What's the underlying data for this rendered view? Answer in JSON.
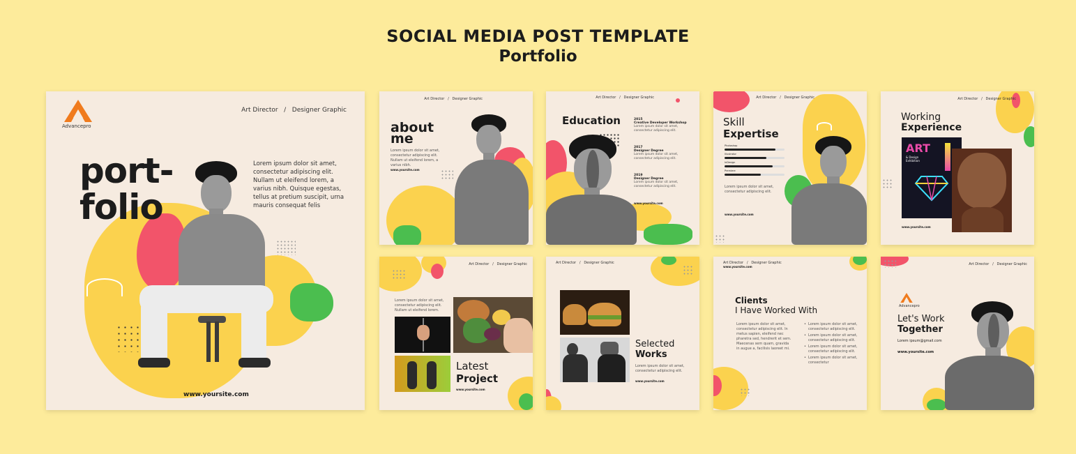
{
  "header": {
    "title": "SOCIAL MEDIA POST TEMPLATE",
    "subtitle": "Portfolio"
  },
  "brand": {
    "name": "Advancepro"
  },
  "colors": {
    "background": "#fdeb9b",
    "card": "#f6ebe0",
    "yellow": "#fbd24e",
    "red": "#f2546a",
    "green": "#4bbe4f",
    "orange": "#f07b1d"
  },
  "cover": {
    "roles": "Art Director   /   Designer Graphic",
    "headline_line1": "port-",
    "headline_line2": "folio",
    "lorem": "Lorem ipsum dolor sit amet, consectetur adipiscing elit. Nullam ut eleifend lorem, a varius nibh. Quisque egestas, tellus at pretium suscipit, urna mauris consequat felis",
    "site": "www.yoursite.com"
  },
  "about": {
    "roles": "Art Director   /   Designer Graphic",
    "title_line1": "about",
    "title_line2": "me",
    "lorem": "Lorem ipsum dolor sit amet, consectetur adipiscing elit. Nullam ut eleifend lorem, a varius nibh.",
    "site": "www.yoursite.com"
  },
  "education": {
    "roles": "Art Director   /   Designer Graphic",
    "title": "Education",
    "entries": [
      {
        "year": "2015",
        "name": "Creative Developer Workshop",
        "text": "Lorem ipsum dolor sit amet, consectetur adipiscing elit."
      },
      {
        "year": "2017",
        "name": "Designer Degree",
        "text": "Lorem ipsum dolor sit amet, consectetur adipiscing elit."
      },
      {
        "year": "2019",
        "name": "Designer Degree",
        "text": "Lorem ipsum dolor sit amet, consectetur adipiscing elit."
      }
    ],
    "site": "www.yoursite.com"
  },
  "skills": {
    "roles": "Art Director   /   Designer Graphic",
    "title_line1": "Skill",
    "title_line2": "Expertise",
    "items": [
      {
        "name": "Photoshop",
        "level": 0.85
      },
      {
        "name": "Illustrator",
        "level": 0.7
      },
      {
        "name": "InDesign",
        "level": 0.8
      },
      {
        "name": "Premiere",
        "level": 0.6
      }
    ],
    "lorem": "Lorem ipsum dolor sit amet, consectetur adipiscing elit.",
    "site": "www.yoursite.com"
  },
  "experience": {
    "roles": "Art Director   /   Designer Graphic",
    "title_line1": "Working",
    "title_line2": "Experience",
    "poster_title": "ART",
    "poster_sub": "& Design Exhibition",
    "site": "www.yoursite.com"
  },
  "project": {
    "roles": "Art Director   /   Designer Graphic",
    "lorem": "Lorem ipsum dolor sit amet, consectetur adipiscing elit. Nullam ut eleifend lorem.",
    "title_line1": "Latest",
    "title_line2": "Project",
    "site": "www.yoursite.com"
  },
  "works": {
    "roles": "Art Director   /   Designer Graphic",
    "title_line1": "Selected",
    "title_line2": "Works",
    "lorem": "Lorem ipsum dolor sit amet, consectetur adipiscing elit.",
    "site": "www.yoursite.com"
  },
  "clients": {
    "roles": "Art Director   /   Designer Graphic",
    "site": "www.yoursite.com",
    "title_line1": "Clients",
    "title_line2": "I Have Worked With",
    "lorem": "Lorem ipsum dolor sit amet, consectetur adipiscing elit. In metus sapien, eleifend nec pharetra sed, hendrerit et sem. Maecenas sem quam, gravida in augue a, facilisis laoreet mi.",
    "bullets": [
      "Lorem ipsum dolor sit amet, consectetur adipiscing elit.",
      "Lorem ipsum dolor sit amet, consectetur adipiscing elit.",
      "Lorem ipsum dolor sit amet, consectetur adipiscing elit.",
      "Lorem ipsum dolor sit amet, consectetur"
    ]
  },
  "together": {
    "roles": "Art Director   /   Designer Graphic",
    "brand": "Advancepro",
    "title_line1": "Let's Work",
    "title_line2": "Together",
    "email": "Lorem ipsum@gmail.com",
    "site": "www.yoursite.com"
  }
}
